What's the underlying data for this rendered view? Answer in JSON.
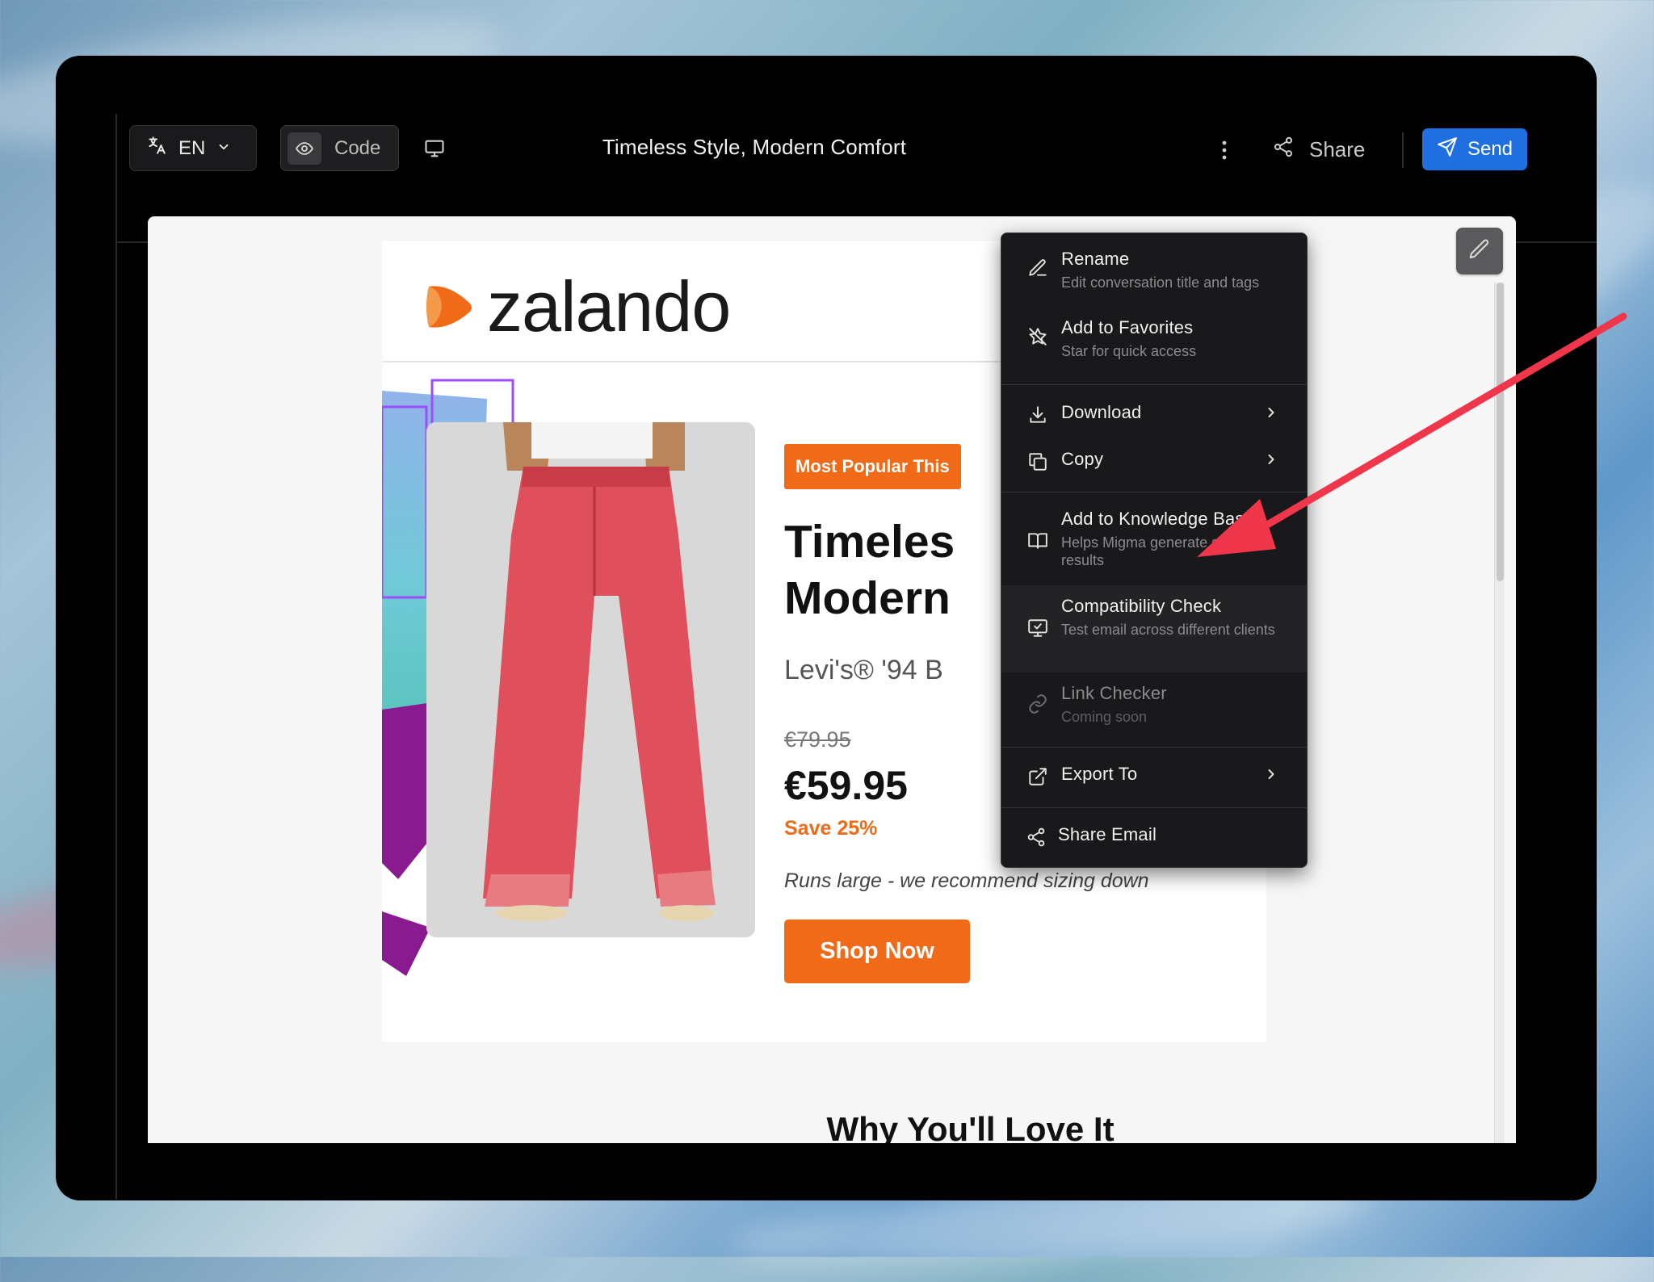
{
  "toolbar": {
    "language": "EN",
    "code_label": "Code",
    "title": "Timeless Style, Modern Comfort",
    "share_label": "Share",
    "send_label": "Send"
  },
  "email": {
    "logo_text": "zalando",
    "badge": "Most Popular This",
    "headline": "Timeles\nModern",
    "subtitle": "Levi's® '94 B",
    "old_price": "€79.95",
    "price": "€59.95",
    "save": "Save 25%",
    "note": "Runs large - we recommend sizing down",
    "cta": "Shop Now",
    "section_title": "Why You'll Love It"
  },
  "menu": {
    "rename": {
      "label": "Rename",
      "desc": "Edit conversation title and tags"
    },
    "favorites": {
      "label": "Add to Favorites",
      "desc": "Star for quick access"
    },
    "download": {
      "label": "Download"
    },
    "copy": {
      "label": "Copy"
    },
    "knowledge": {
      "label": "Add to Knowledge Base",
      "desc": "Helps Migma generate similar results"
    },
    "compat": {
      "label": "Compatibility Check",
      "desc": "Test email across different clients"
    },
    "linkcheck": {
      "label": "Link Checker",
      "desc": "Coming soon"
    },
    "export": {
      "label": "Export To"
    },
    "share_email": {
      "label": "Share Email"
    }
  },
  "colors": {
    "accent_blue": "#1f6fe0",
    "brand_orange": "#f06a17",
    "annotation_arrow": "#f0364a"
  },
  "icons": [
    "translate-icon",
    "chevron-down-icon",
    "eye-icon",
    "monitor-icon",
    "more-vertical-icon",
    "share-icon",
    "send-icon",
    "pencil-icon",
    "star-off-icon",
    "download-icon",
    "copy-icon",
    "book-icon",
    "monitor-check-icon",
    "link-icon",
    "external-link-icon",
    "chevron-right-icon"
  ]
}
